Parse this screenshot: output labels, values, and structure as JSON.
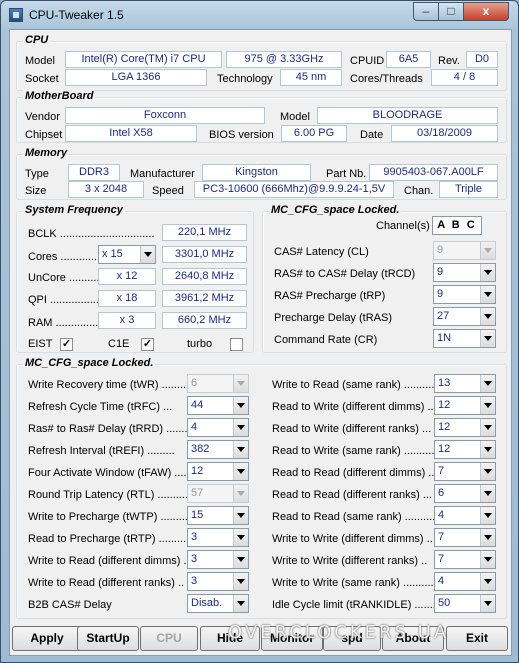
{
  "window": {
    "title": "CPU-Tweaker 1.5",
    "min": "–",
    "max": "□",
    "close": "x"
  },
  "cpu": {
    "heading": "CPU",
    "model_label": "Model",
    "model_name": "Intel(R) Core(TM) i7 CPU",
    "model_num": "975  @ 3.33GHz",
    "cpuid_label": "CPUID",
    "cpuid": "6A5",
    "rev_label": "Rev.",
    "rev": "D0",
    "socket_label": "Socket",
    "socket": "LGA 1366",
    "tech_label": "Technology",
    "tech": "45 nm",
    "ct_label": "Cores/Threads",
    "ct": "4 / 8"
  },
  "mb": {
    "heading": "MotherBoard",
    "vendor_label": "Vendor",
    "vendor": "Foxconn",
    "model_label": "Model",
    "model": "BLOODRAGE",
    "chipset_label": "Chipset",
    "chipset": "Intel X58",
    "bios_label": "BIOS version",
    "bios": "6.00 PG",
    "date_label": "Date",
    "date": "03/18/2009"
  },
  "mem": {
    "heading": "Memory",
    "type_label": "Type",
    "type": "DDR3",
    "manu_label": "Manufacturer",
    "manu": "Kingston",
    "part_label": "Part Nb.",
    "part": "9905403-067.A00LF",
    "size_label": "Size",
    "size": "3 x 2048",
    "speed_label": "Speed",
    "speed": "PC3-10600 (666Mhz)@9.9.9.24-1,5V",
    "chan_label": "Chan.",
    "chan": "Triple"
  },
  "freq": {
    "heading": "System Frequency",
    "bclk_label": "BCLK ...............................",
    "bclk": "220,1 MHz",
    "cores_label": "Cores ..............",
    "cores_mult": "x 15",
    "cores": "3301,0 MHz",
    "uncore_label": "UnCore ...........",
    "uncore_mult": "x 12",
    "uncore": "2640,8 MHz",
    "qpi_label": "QPI ...................",
    "qpi_mult": "x 18",
    "qpi": "3961,2 MHz",
    "ram_label": "RAM .................",
    "ram_mult": "x 3",
    "ram": "660,2 MHz",
    "eist_label": "EIST",
    "c1e_label": "C1E",
    "turbo_label": "turbo",
    "eist": "✓",
    "c1e": "✓",
    "turbo": ""
  },
  "mc1": {
    "heading": "MC_CFG_space Locked.",
    "channels_label": "Channel(s)",
    "channels": "A B C",
    "cl_label": "CAS# Latency (CL)",
    "cl": "9",
    "trcd_label": "RAS# to CAS# Delay (tRCD)",
    "trcd": "9",
    "trp_label": "RAS# Precharge (tRP)",
    "trp": "9",
    "tras_label": "Precharge Delay (tRAS)",
    "tras": "27",
    "cr_label": "Command Rate (CR)",
    "cr": "1N"
  },
  "mc2": {
    "heading": "MC_CFG_space Locked.",
    "left": [
      {
        "label": "Write Recovery time (tWR) ............",
        "value": "6",
        "disabled": true
      },
      {
        "label": "Refresh Cycle Time (tRFC) ...",
        "value": "44",
        "disabled": false
      },
      {
        "label": "Ras# to Ras# Delay (tRRD) ..........",
        "value": "4",
        "disabled": false
      },
      {
        "label": "Refresh Interval (tREFI) .........",
        "value": "382",
        "disabled": false
      },
      {
        "label": "Four Activate Window (tFAW) ......",
        "value": "12",
        "disabled": false
      },
      {
        "label": "Round Trip Latency (RTL) ..........",
        "value": "57",
        "disabled": true
      },
      {
        "label": "Write to Precharge (tWTP) ............",
        "value": "15",
        "disabled": false
      },
      {
        "label": "Read to Precharge (tRTP) ..............",
        "value": "3",
        "disabled": false
      },
      {
        "label": "Write to Read (different dimms) .",
        "value": "3",
        "disabled": false
      },
      {
        "label": "Write to Read (different ranks) ..",
        "value": "3",
        "disabled": false
      },
      {
        "label": "B2B CAS# Delay",
        "value": "Disab.",
        "disabled": false
      }
    ],
    "right": [
      {
        "label": "Write to Read (same rank) ...........",
        "value": "13"
      },
      {
        "label": "Read to Write (different dimms) ...",
        "value": "12"
      },
      {
        "label": "Read to Write (different ranks) ...",
        "value": "12"
      },
      {
        "label": "Read to Write (same rank) ...........",
        "value": "12"
      },
      {
        "label": "Read to Read (different dimms) ...",
        "value": "7"
      },
      {
        "label": "Read to Read (different ranks) ...",
        "value": "6"
      },
      {
        "label": "Read to Read (same rank) ...........",
        "value": "4"
      },
      {
        "label": "Write to Write (different dimms) ..",
        "value": "7"
      },
      {
        "label": "Write to Write (different ranks) ..",
        "value": "7"
      },
      {
        "label": "Write to Write (same rank) ...........",
        "value": "4"
      },
      {
        "label": "Idle Cycle limit (tRANKIDLE) .........",
        "value": "50"
      }
    ]
  },
  "buttons": {
    "apply": "Apply",
    "startup": "StartUp",
    "cpu": "CPU",
    "hide": "Hide",
    "monitor": "Monitor",
    "spd": "spd",
    "about": "About",
    "exit": "Exit"
  },
  "watermark": "OVERCLOCKERS.UA"
}
